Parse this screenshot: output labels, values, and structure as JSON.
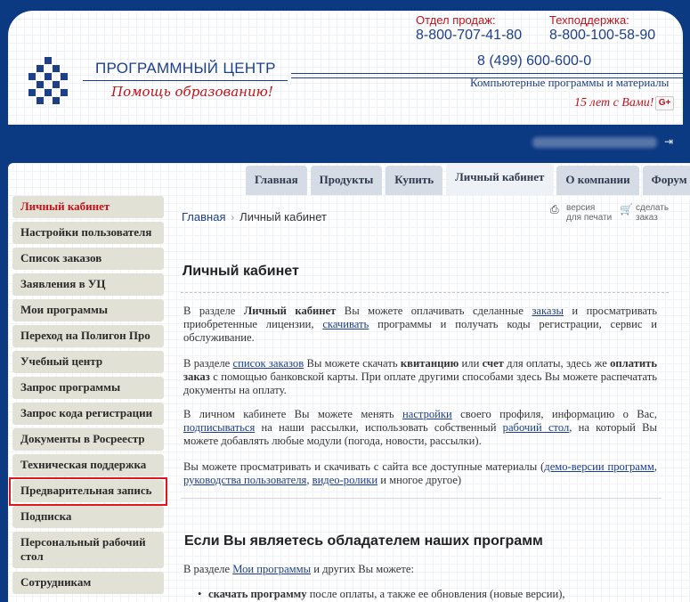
{
  "header": {
    "brand_title": "ПРОГРАММНЫЙ ЦЕНТР",
    "brand_slogan": "Помощь образованию!",
    "sales_label": "Отдел продаж:",
    "sales_phone": "8-800-707-41-80",
    "support_label": "Техподдержка:",
    "support_phone": "8-800-100-58-90",
    "main_phone": "8 (499) 600-600-0",
    "tagline": "Компьютерные программы и материалы",
    "years": "15 лет с Вами!",
    "gplus": "G+"
  },
  "tabs": [
    {
      "label": "Главная"
    },
    {
      "label": "Продукты"
    },
    {
      "label": "Купить"
    },
    {
      "label": "Личный кабинет"
    },
    {
      "label": "О компании"
    },
    {
      "label": "Форум"
    }
  ],
  "sidebar": [
    {
      "label": "Личный кабинет"
    },
    {
      "label": "Настройки пользователя"
    },
    {
      "label": "Список заказов"
    },
    {
      "label": "Заявления в УЦ"
    },
    {
      "label": "Мои программы"
    },
    {
      "label": "Переход на Полигон Про"
    },
    {
      "label": "Учебный центр"
    },
    {
      "label": "Запрос программы"
    },
    {
      "label": "Запрос кода регистрации"
    },
    {
      "label": "Документы в Росреестр"
    },
    {
      "label": "Техническая поддержка"
    },
    {
      "label": "Предварительная запись"
    },
    {
      "label": "Подписка"
    },
    {
      "label": "Персональный рабочий стол"
    },
    {
      "label": "Сотрудникам"
    }
  ],
  "breadcrumb": {
    "home": "Главная",
    "current": "Личный кабинет"
  },
  "tools": {
    "print_l1": "версия",
    "print_l2": "для печати",
    "order_l1": "сделать",
    "order_l2": "заказ"
  },
  "article": {
    "title": "Личный кабинет",
    "p1": {
      "a": "В разделе ",
      "b": "Личный кабинет",
      "c": " Вы можете оплачивать сделанные ",
      "link1": "заказы",
      "d": " и просматривать приобретенные лицензии, ",
      "link2": "скачивать",
      "e": " программы и получать коды регистрации, сервис и обслуживание."
    },
    "p2": {
      "a": "В разделе ",
      "link1": "список заказов",
      "b": " Вы можете скачать ",
      "bold1": "квитанцию",
      "c": " или ",
      "bold2": "счет",
      "d": " для оплаты, здесь же ",
      "bold3": "оплатить заказ",
      "e": " с помощью банковской карты. При оплате другими способами здесь Вы можете распечатать документы на оплату."
    },
    "p3": {
      "a": "В личном кабинете Вы можете менять ",
      "link1": "настройки",
      "b": " своего профиля, информацию о Вас, ",
      "link2": "подписываться",
      "c": " на наши рассылки, использовать собственный ",
      "link3": "рабочий стол",
      "d": ", на который Вы можете добавлять любые модули (погода, новости, рассылки)."
    },
    "p4": {
      "a": "Вы можете просматривать и скачивать с сайта все доступные материалы (",
      "link1": "демо-версии программ",
      "b": ", ",
      "link2": "руководства пользователя",
      "c": ", ",
      "link3": "видео-ролики",
      "d": " и многое другое)"
    },
    "h2": "Если Вы являетесь обладателем наших программ",
    "p5": {
      "a": "В разделе ",
      "link1": "Мои программы",
      "b": " и других Вы можете:"
    },
    "bullet1": {
      "bold": "скачать программу",
      "rest": " после оплаты, а также ее обновления (новые версии),"
    }
  }
}
